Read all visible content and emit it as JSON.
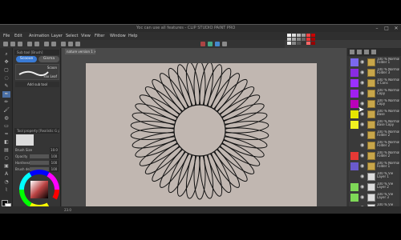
{
  "window": {
    "title": "Yoc can use all features - CLIP STUDIO PAINT PRO",
    "controls": [
      "–",
      "□",
      "✕"
    ]
  },
  "menu": [
    "File",
    "Edit",
    "Animation",
    "Layer",
    "Select",
    "View",
    "Filter",
    "Window",
    "Help"
  ],
  "sub_tool": {
    "tab_label": "Sub tool [Brush]",
    "pills": [
      "Scoove",
      "Gisma"
    ],
    "brush_name": "Scoon",
    "brush_sub": "Fax Leaf",
    "add_label": "Add sub tool",
    "prop_header": "Tool property [Realistic G pencil]",
    "props": [
      {
        "label": "Brush Size",
        "value": "10.0"
      },
      {
        "label": "Opacity",
        "value": "100"
      },
      {
        "label": "Hardness",
        "value": "100"
      },
      {
        "label": "Brush density",
        "value": "100"
      }
    ]
  },
  "document": {
    "tab_label": "nature version 1 ✕",
    "status": "nature version 1 * (1774 x 2480px 350dpi 23.0%)  Yoc can use all features"
  },
  "layers": [
    {
      "color": "#7b68ee",
      "name": "100 % Normal\nFolder 1",
      "folder": true
    },
    {
      "color": "#8a2be2",
      "name": "100 % Normal\nFolder 3",
      "folder": true
    },
    {
      "color": "#9b30ff",
      "name": "100 % Normal\nS Cons",
      "folder": true
    },
    {
      "color": "#a020f0",
      "name": "100 % Normal\nCopy",
      "folder": true
    },
    {
      "color": "#b0b",
      "name": "100 % Normal\nCopy",
      "folder": true
    },
    {
      "color": "#e6e600",
      "name": "100 % Normal\nBase",
      "folder": true
    },
    {
      "color": "#f0f020",
      "name": "100 % Normal\nBase Copy",
      "folder": true
    },
    {
      "color": "#3a3a3a",
      "name": "100 % Normal\nFolder 2",
      "folder": true
    },
    {
      "color": "#3a3a3a",
      "name": "100 % Normal\nFolder 2",
      "folder": true
    },
    {
      "color": "#e53935",
      "name": "100 % Normal\nFolder 2",
      "folder": true
    },
    {
      "color": "#6a5acd",
      "name": "100 % Normal\nFolder 1",
      "folder": true
    },
    {
      "color": "#3a3a3a",
      "name": "100 % Vie\nLayer 1",
      "folder": false
    },
    {
      "color": "#7ed957",
      "name": "100 % Vie\nLayer 2",
      "folder": false
    },
    {
      "color": "#7ed957",
      "name": "100 % Vie\nLayer 3",
      "folder": false
    },
    {
      "color": "#3a3a3a",
      "name": "100 % Vie\nLayer 4",
      "folder": false
    }
  ],
  "accent": "#3a7bd5",
  "zoom": "23.0"
}
